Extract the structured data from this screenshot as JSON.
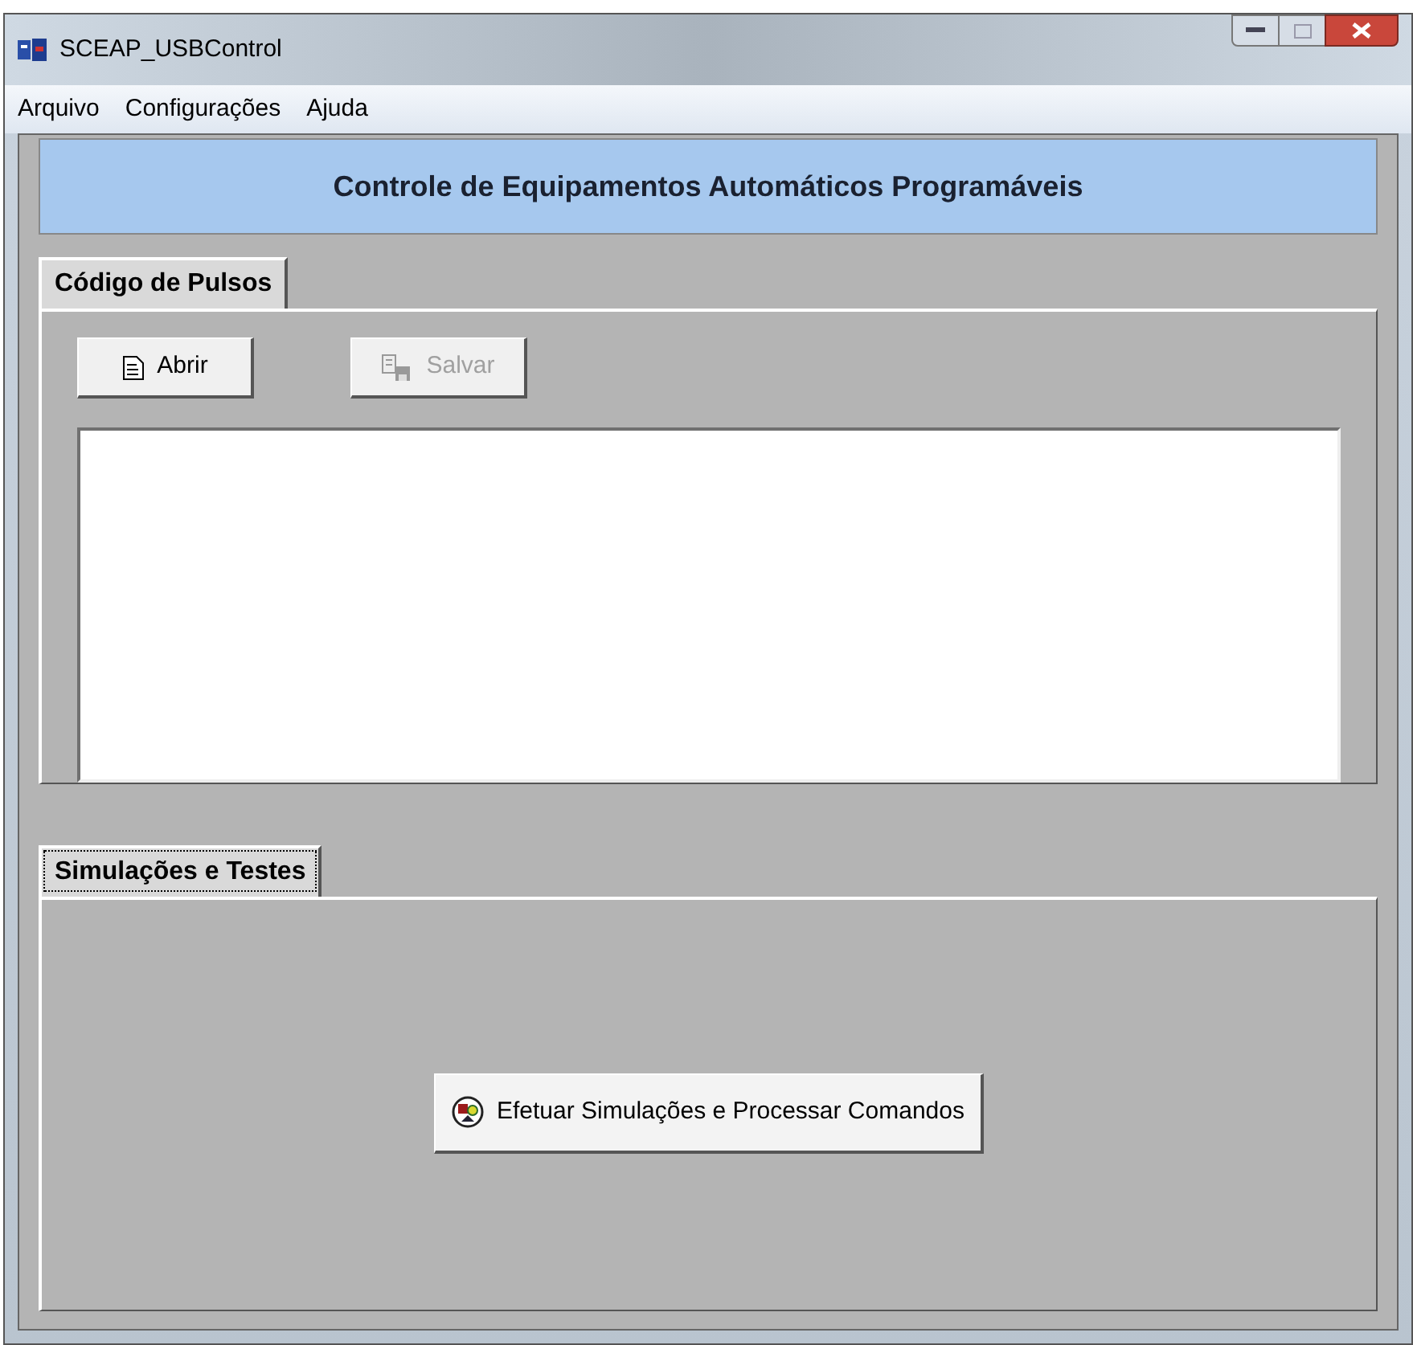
{
  "window": {
    "title": "SCEAP_USBControl"
  },
  "menu": [
    "Arquivo",
    "Configurações",
    "Ajuda"
  ],
  "header": "Controle de Equipamentos Automáticos Programáveis",
  "pulse_panel": {
    "tab": {
      "label": "Código de Pulsos",
      "selected": true,
      "focused": false
    },
    "buttons": [
      {
        "kind": "open",
        "label": "Abrir",
        "disabled": false
      },
      {
        "kind": "save",
        "label": "Salvar",
        "disabled": true
      }
    ]
  },
  "test_panel": {
    "tab": {
      "label": "Simulações e Testes",
      "selected": true,
      "focused": true
    },
    "button": {
      "label": "Efetuar Simulações e Processar Comandos"
    }
  }
}
